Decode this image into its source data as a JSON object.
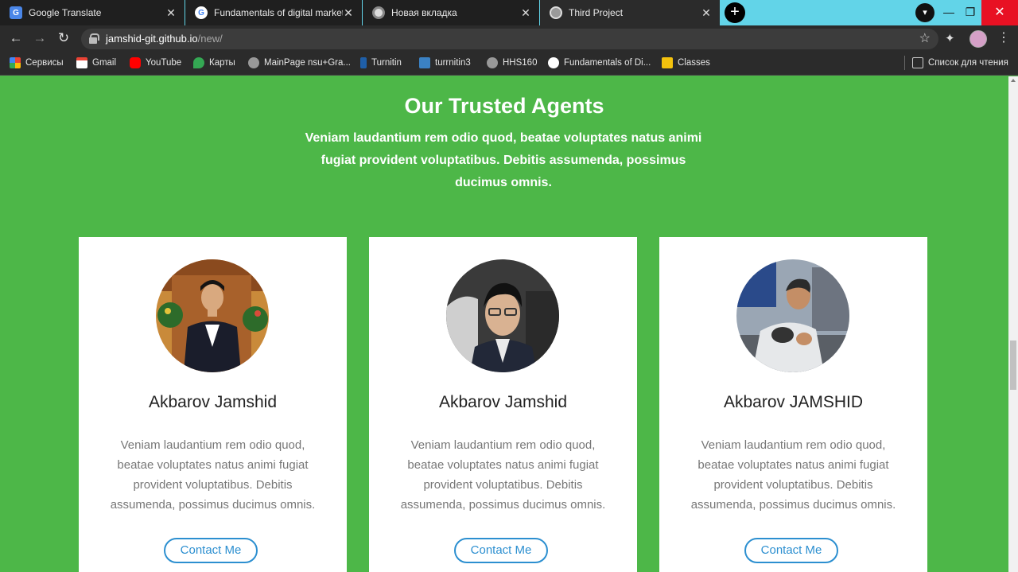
{
  "browser": {
    "tabs": [
      {
        "title": "Google Translate"
      },
      {
        "title": "Fundamentals of digital marketing"
      },
      {
        "title": "Новая вкладка"
      },
      {
        "title": "Third Project"
      }
    ],
    "url_host": "jamshid-git.github.io",
    "url_path": "/new/",
    "bookmarks": [
      {
        "label": "Сервисы"
      },
      {
        "label": "Gmail"
      },
      {
        "label": "YouTube"
      },
      {
        "label": "Карты"
      },
      {
        "label": "MainPage nsu+Gra..."
      },
      {
        "label": "Turnitin"
      },
      {
        "label": "turrnitin3"
      },
      {
        "label": "HHS160"
      },
      {
        "label": "Fundamentals of Di..."
      },
      {
        "label": "Classes"
      }
    ],
    "reading_list": "Список для чтения"
  },
  "section": {
    "title": "Our Trusted Agents",
    "subtitle": "Veniam laudantium rem odio quod, beatae voluptates natus animi fugiat provident voluptatibus. Debitis assumenda, possimus ducimus omnis."
  },
  "agents": [
    {
      "name": "Akbarov Jamshid",
      "description": "Veniam laudantium rem odio quod, beatae voluptates natus animi fugiat provident voluptatibus. Debitis assumenda, possimus ducimus omnis.",
      "button": "Contact Me"
    },
    {
      "name": "Akbarov Jamshid",
      "description": "Veniam laudantium rem odio quod, beatae voluptates natus animi fugiat provident voluptatibus. Debitis assumenda, possimus ducimus omnis.",
      "button": "Contact Me"
    },
    {
      "name": "Akbarov JAMSHID",
      "description": "Veniam laudantium rem odio quod, beatae voluptates natus animi fugiat provident voluptatibus. Debitis assumenda, possimus ducimus omnis.",
      "button": "Contact Me"
    }
  ],
  "colors": {
    "page_background": "#4db748",
    "button_accent": "#2c8fd0",
    "card_background": "#ffffff"
  }
}
